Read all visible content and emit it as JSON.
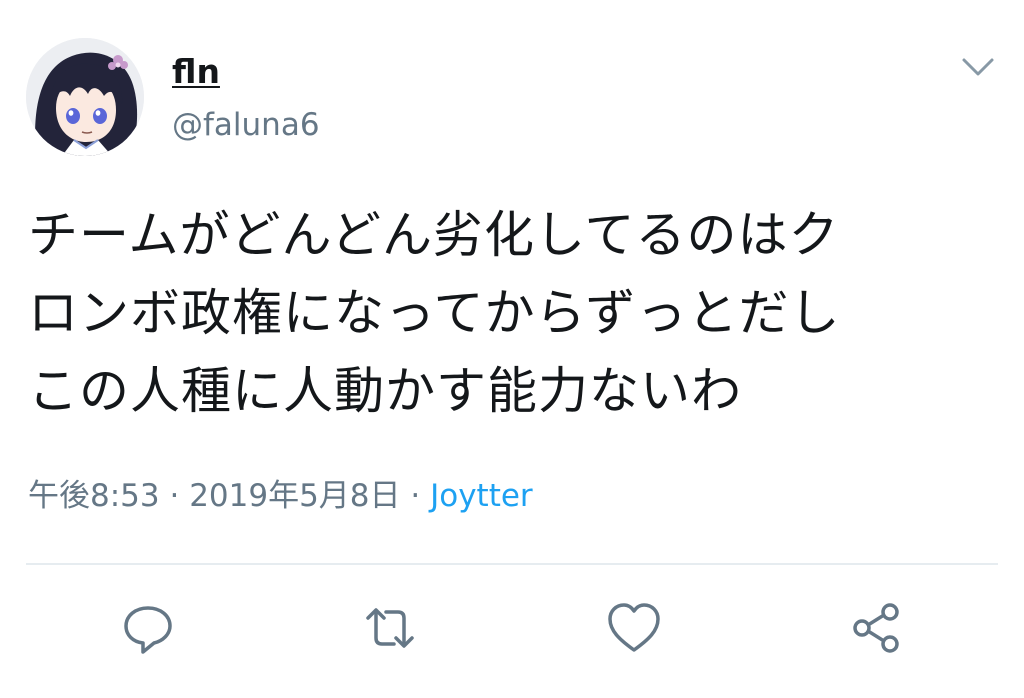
{
  "user": {
    "name": "fln",
    "handle": "@faluna6"
  },
  "tweet": {
    "lines": [
      "チームがどんどん劣化してるのはク",
      "ロンボ政権になってからずっとだし",
      "この人種に人動かす能力ないわ"
    ]
  },
  "meta": {
    "time": "午後8:53",
    "separator1": " · ",
    "date": "2019年5月8日",
    "separator2": " · ",
    "client": "Joytter"
  },
  "icons": {
    "menu": "chevron-down-icon",
    "reply": "reply-icon",
    "retweet": "retweet-icon",
    "like": "heart-icon",
    "share": "share-icon"
  },
  "colors": {
    "text": "#14171a",
    "secondary": "#657786",
    "link": "#1da1f2",
    "divider": "#e6ecf0"
  }
}
